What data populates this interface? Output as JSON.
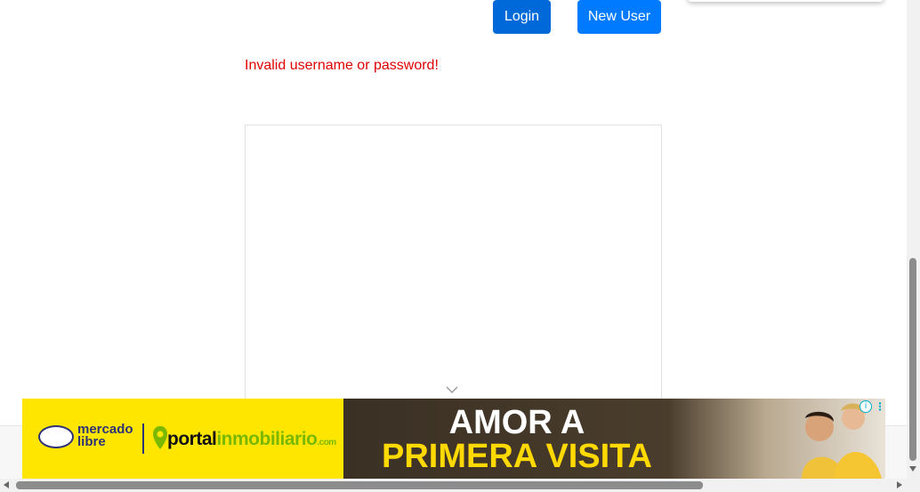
{
  "buttons": {
    "login_label": "Login",
    "new_user_label": "New User"
  },
  "error_message": "Invalid username or password!",
  "ad": {
    "brand_1_line1": "mercado",
    "brand_1_line2": "libre",
    "brand_2_part1": "portal",
    "brand_2_part2": "inmobiliario",
    "brand_2_part3": ".com",
    "headline_line1": "AMOR A",
    "headline_line2": "PRIMERA VISITA",
    "adchoices_icon": "info-icon",
    "menu_icon": "⋮"
  },
  "colors": {
    "login_button": "#0069d9",
    "new_user_button": "#007bff",
    "error_text": "#e00000",
    "ad_yellow": "#ffe600",
    "headline_yellow": "#ffd900"
  }
}
